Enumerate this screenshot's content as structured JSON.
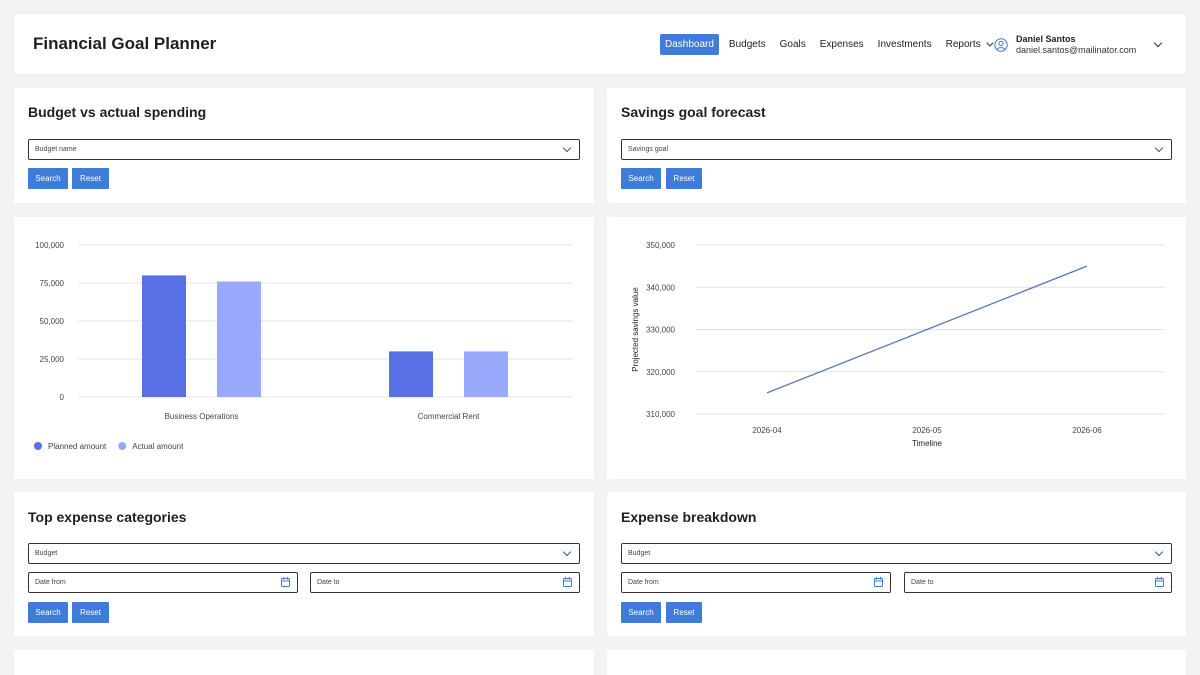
{
  "header": {
    "title": "Financial Goal Planner",
    "nav": [
      {
        "label": "Dashboard",
        "active": true
      },
      {
        "label": "Budgets"
      },
      {
        "label": "Goals"
      },
      {
        "label": "Expenses"
      },
      {
        "label": "Investments"
      },
      {
        "label": "Reports",
        "has_dropdown": true
      }
    ],
    "user": {
      "name": "Daniel Santos",
      "email": "daniel.santos@mailinator.com"
    }
  },
  "budget_panel": {
    "title": "Budget vs actual spending",
    "select_placeholder": "Budget name",
    "search_label": "Search",
    "reset_label": "Reset"
  },
  "savings_panel": {
    "title": "Savings goal forecast",
    "select_placeholder": "Savings goal",
    "search_label": "Search",
    "reset_label": "Reset"
  },
  "top_expense_panel": {
    "title": "Top expense categories",
    "select_placeholder": "Budget",
    "date_from": "Date from",
    "date_to": "Date to",
    "search_label": "Search",
    "reset_label": "Reset"
  },
  "breakdown_panel": {
    "title": "Expense breakdown",
    "select_placeholder": "Budget",
    "date_from": "Date from",
    "date_to": "Date to",
    "search_label": "Search",
    "reset_label": "Reset"
  },
  "colors": {
    "accent": "#3f7bd8",
    "planned": "#5a71e6",
    "actual": "#98a9fb",
    "line": "#5b78b8",
    "grid": "#e3e3e3"
  },
  "chart_data": [
    {
      "type": "bar",
      "categories": [
        "Business Operations",
        "Commercial Rent"
      ],
      "series": [
        {
          "name": "Planned amount",
          "values": [
            80000,
            30000
          ]
        },
        {
          "name": "Actual amount",
          "values": [
            76000,
            30000
          ]
        }
      ],
      "yticks": [
        "0",
        "25,000",
        "50,000",
        "75,000",
        "100,000"
      ],
      "ylim": [
        0,
        100000
      ],
      "grid": true,
      "legend": "bottom-left"
    },
    {
      "type": "line",
      "x": [
        "2026-04",
        "2026-05",
        "2026-06"
      ],
      "series": [
        {
          "values": [
            315000,
            330000,
            345000
          ]
        }
      ],
      "xlabel": "Timeline",
      "ylabel": "Projected savings value",
      "yticks": [
        "310,000",
        "320,000",
        "330,000",
        "340,000",
        "350,000"
      ],
      "ylim": [
        310000,
        350000
      ],
      "grid": true
    }
  ]
}
